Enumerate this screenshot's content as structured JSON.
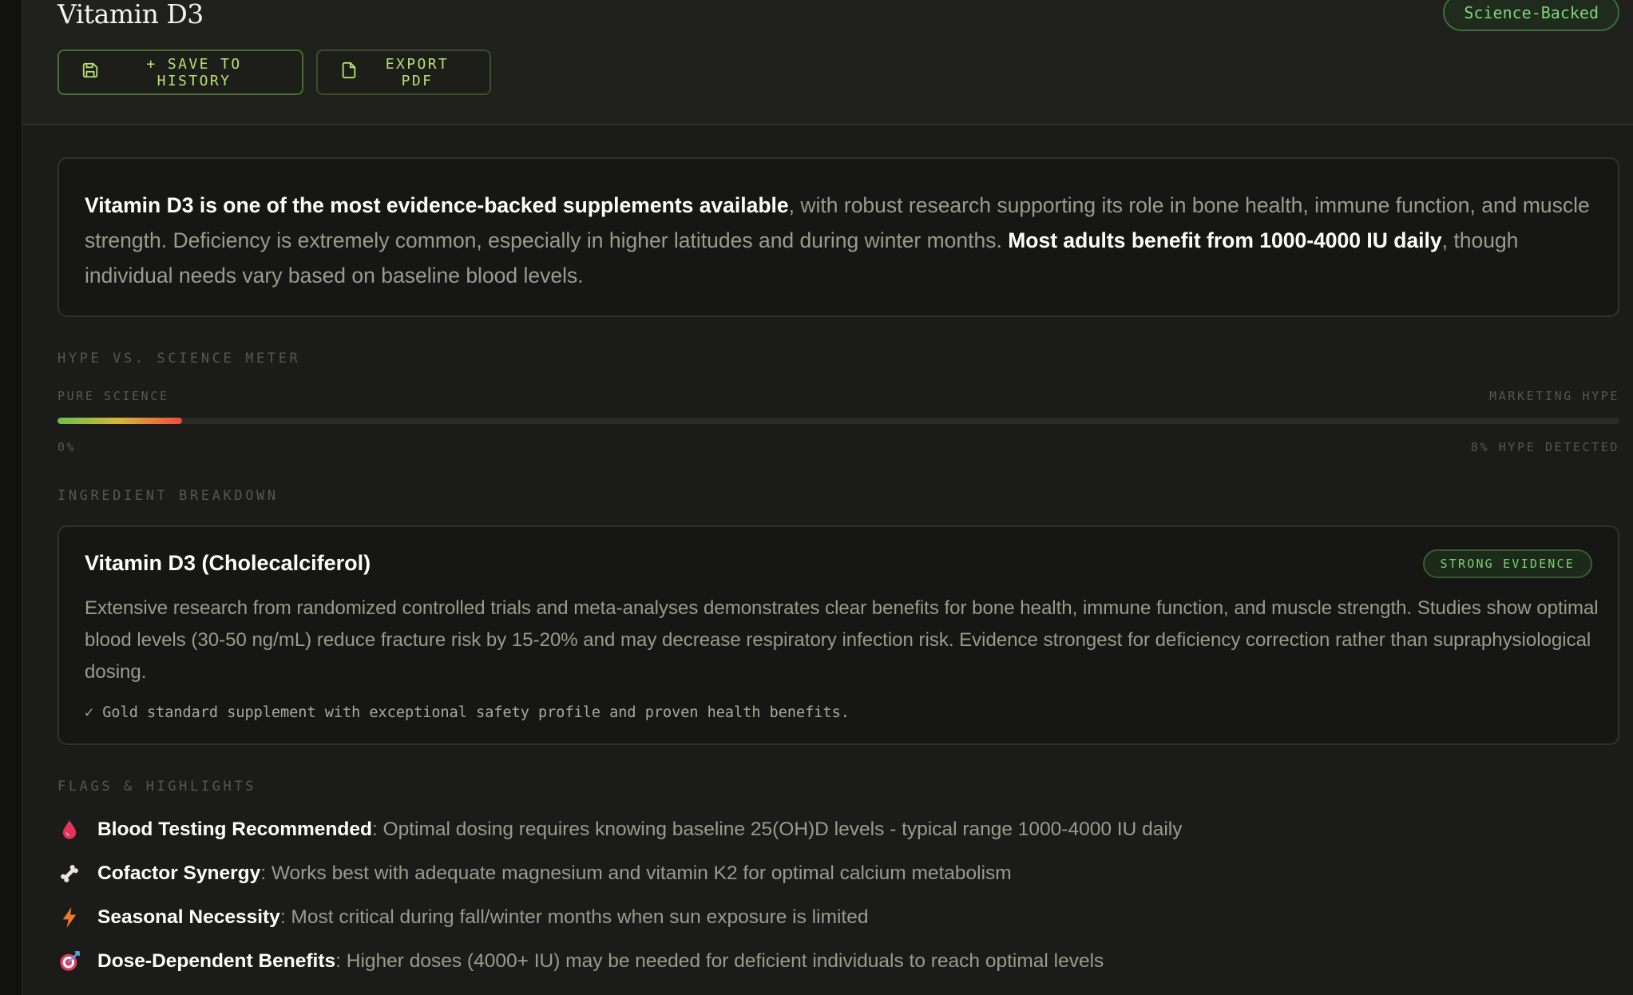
{
  "header": {
    "title": "Vitamin D3",
    "verdict_badge": "Science-Backed",
    "save_button": "+ SAVE TO HISTORY",
    "export_button": "EXPORT PDF"
  },
  "summary": {
    "bold_1": "Vitamin D3 is one of the most evidence-backed supplements available",
    "text_1": ", with robust research supporting its role in bone health, immune function, and muscle strength. Deficiency is extremely common, especially in higher latitudes and during winter months. ",
    "bold_2": "Most adults benefit from 1000-4000 IU daily",
    "text_2": ", though individual needs vary based on baseline blood levels."
  },
  "meter": {
    "section_title": "HYPE VS. SCIENCE METER",
    "left_label": "PURE SCIENCE",
    "right_label": "MARKETING HYPE",
    "min_label": "0%",
    "result_label": "8% HYPE DETECTED",
    "hype_percent": 8
  },
  "ingredients": {
    "section_title": "INGREDIENT BREAKDOWN",
    "items": [
      {
        "name": "Vitamin D3 (Cholecalciferol)",
        "evidence": "STRONG EVIDENCE",
        "description": "Extensive research from randomized controlled trials and meta-analyses demonstrates clear benefits for bone health, immune function, and muscle strength. Studies show optimal blood levels (30-50 ng/mL) reduce fracture risk by 15-20% and may decrease respiratory infection risk. Evidence strongest for deficiency correction rather than supraphysiological dosing.",
        "note": "✓ Gold standard supplement with exceptional safety profile and proven health benefits."
      }
    ]
  },
  "flags": {
    "section_title": "FLAGS & HIGHLIGHTS",
    "items": [
      {
        "icon": "blood-drop-icon",
        "title": "Blood Testing Recommended",
        "text": ": Optimal dosing requires knowing baseline 25(OH)D levels - typical range 1000-4000 IU daily"
      },
      {
        "icon": "bone-icon",
        "title": "Cofactor Synergy",
        "text": ": Works best with adequate magnesium and vitamin K2 for optimal calcium metabolism"
      },
      {
        "icon": "lightning-icon",
        "title": "Seasonal Necessity",
        "text": ": Most critical during fall/winter months when sun exposure is limited"
      },
      {
        "icon": "target-icon",
        "title": "Dose-Dependent Benefits",
        "text": ": Higher doses (4000+ IU) may be needed for deficient individuals to reach optimal levels"
      }
    ]
  },
  "colors": {
    "accent_green": "#b8e070",
    "badge_green": "#7fd47f",
    "meter_start": "#6bbf4e",
    "meter_end": "#ef4d3b"
  }
}
